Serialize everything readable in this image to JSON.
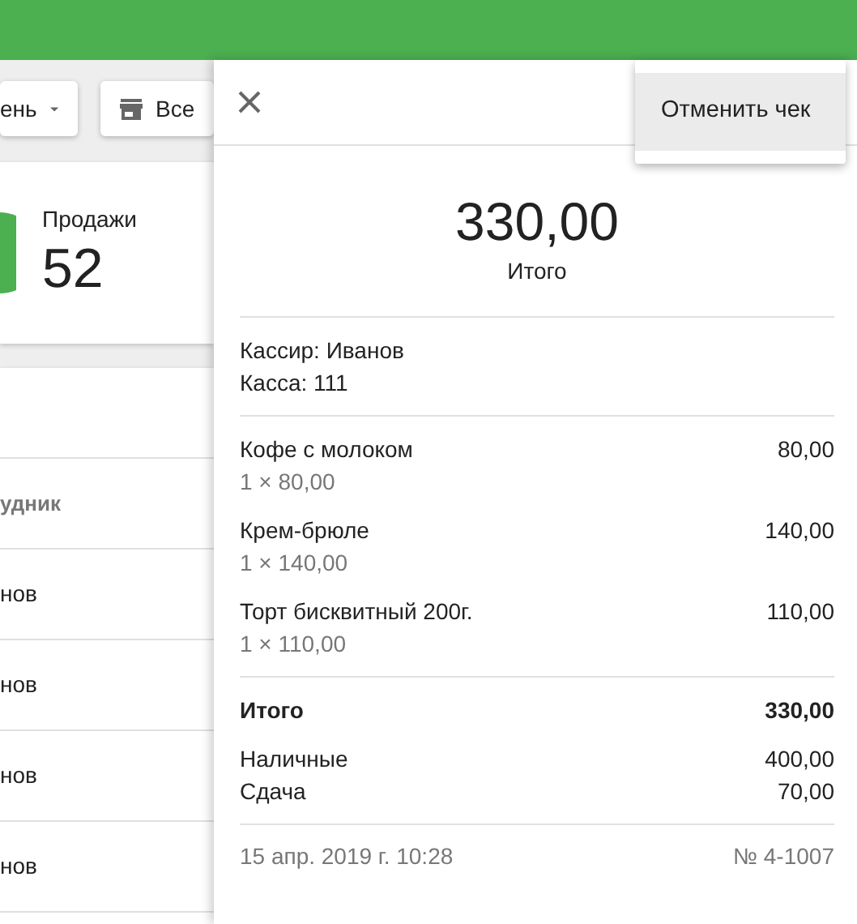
{
  "background": {
    "filters": [
      {
        "kind": "dropdown",
        "label": "ень"
      },
      {
        "kind": "store",
        "label": "Все"
      }
    ],
    "stat": {
      "label": "Продажи",
      "value": "52"
    },
    "table": {
      "column_header": "удник",
      "rows": [
        "нов",
        "нов",
        "нов",
        "нов"
      ]
    }
  },
  "receipt": {
    "total": "330,00",
    "total_label": "Итого",
    "info": [
      "Кассир: Иванов",
      "Касса: 111"
    ],
    "items": [
      {
        "name": "Кофе с молоком",
        "amount": "80,00",
        "detail": "1 × 80,00"
      },
      {
        "name": "Крем-брюле",
        "amount": "140,00",
        "detail": "1 × 140,00"
      },
      {
        "name": "Торт бисквитный 200г.",
        "amount": "110,00",
        "detail": "1 × 110,00"
      }
    ],
    "summary": {
      "label": "Итого",
      "amount": "330,00"
    },
    "payments": [
      {
        "label": "Наличные",
        "amount": "400,00"
      },
      {
        "label": "Сдача",
        "amount": "70,00"
      }
    ],
    "date": "15 апр. 2019 г. 10:28",
    "number": "№ 4-1007"
  },
  "menu": {
    "items": [
      {
        "label": "Отменить чек",
        "selected": true
      }
    ]
  }
}
